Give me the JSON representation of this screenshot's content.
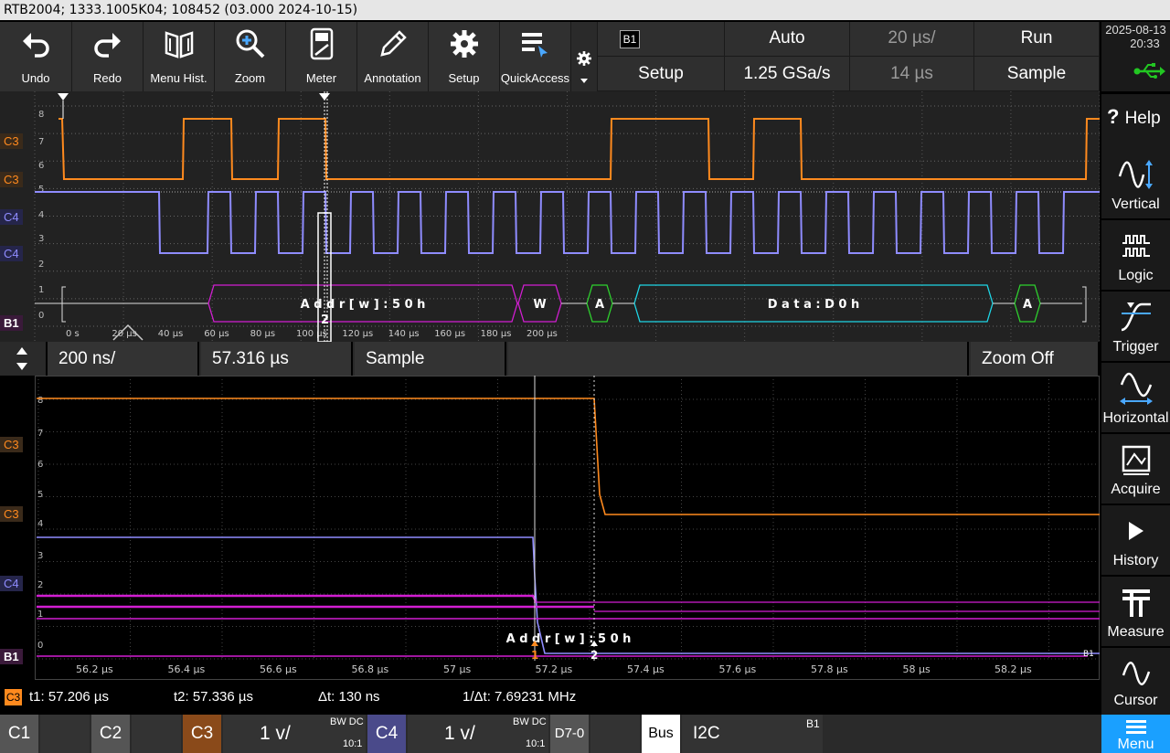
{
  "title": "RTB2004; 1333.1005K04; 108452 (03.000 2024-10-15)",
  "toolbar": {
    "buttons": [
      {
        "label": "Undo",
        "icon": "undo-icon"
      },
      {
        "label": "Redo",
        "icon": "redo-icon"
      },
      {
        "label": "Menu Hist.",
        "icon": "book-icon"
      },
      {
        "label": "Zoom",
        "icon": "zoom-icon"
      },
      {
        "label": "Meter",
        "icon": "meter-icon"
      },
      {
        "label": "Annotation",
        "icon": "pencil-icon"
      },
      {
        "label": "Setup",
        "icon": "gear-icon"
      },
      {
        "label": "QuickAccess",
        "icon": "quickaccess-icon"
      }
    ],
    "bus_tag": "B1",
    "bus_setup": "Setup",
    "trigger_mode": "Auto",
    "sample_rate": "1.25 GSa/s",
    "timebase": "20 µs/",
    "position": "14 µs",
    "run_state": "Run",
    "acq_mode": "Sample"
  },
  "datetime": {
    "date": "2025-08-13",
    "time": "20:33"
  },
  "sidebar": [
    {
      "label": "Help",
      "icon": "help-icon",
      "prefix": "?"
    },
    {
      "label": "Vertical",
      "icon": "vertical-icon"
    },
    {
      "label": "Logic",
      "icon": "logic-icon"
    },
    {
      "label": "Trigger",
      "icon": "trigger-icon"
    },
    {
      "label": "Horizontal",
      "icon": "horizontal-icon"
    },
    {
      "label": "Acquire",
      "icon": "acquire-icon"
    },
    {
      "label": "History",
      "icon": "history-icon"
    },
    {
      "label": "Measure",
      "icon": "measure-icon"
    },
    {
      "label": "Cursor",
      "icon": "cursor-icon"
    }
  ],
  "overview": {
    "y_ticks": [
      "8",
      "7",
      "6",
      "5",
      "4",
      "3",
      "2",
      "1",
      "0"
    ],
    "x_ticks": [
      "0 s",
      "20 µs",
      "40 µs",
      "60 µs",
      "80 µs",
      "100 µs",
      "120 µs",
      "140 µs",
      "160 µs",
      "180 µs",
      "200 µs"
    ],
    "channel_labels": [
      "C3",
      "C3",
      "C4",
      "C4",
      "B1"
    ],
    "decode": [
      "A d d r [ w ] : 5 0 h",
      "W",
      "A",
      "D a t a : D 0 h",
      "A"
    ],
    "marker": "2"
  },
  "zoom": {
    "timebase": "200 ns/",
    "position": "57.316 µs",
    "mode": "Sample",
    "zoom_off": "Zoom Off",
    "y_ticks": [
      "8",
      "7",
      "6",
      "5",
      "4",
      "3",
      "2",
      "1",
      "0"
    ],
    "x_ticks": [
      "56.2 µs",
      "56.4 µs",
      "56.6 µs",
      "56.8 µs",
      "57 µs",
      "57.2 µs",
      "57.4 µs",
      "57.6 µs",
      "57.8 µs",
      "58 µs",
      "58.2 µs"
    ],
    "channel_labels": [
      "C3",
      "C3",
      "C4",
      "B1"
    ],
    "decode": "A d d r [ w ] : 5 0 h",
    "cursor1": "1",
    "cursor2": "2",
    "b1_end": "B1"
  },
  "cursor": {
    "source": "C3",
    "t1": "t1: 57.206 µs",
    "t2": "t2: 57.336 µs",
    "dt": "Δt: 130 ns",
    "inv_dt": "1/Δt: 7.69231 MHz"
  },
  "bottom": {
    "c1": "C1",
    "c2": "C2",
    "c3": "C3",
    "c3_scale": "1 v/",
    "c3_bw": "BW DC",
    "c3_probe": "10:1",
    "c4": "C4",
    "c4_scale": "1 v/",
    "c4_bw": "BW DC",
    "c4_probe": "10:1",
    "d70": "D7-0",
    "bus": "Bus",
    "bus_type": "I2C",
    "bus_tag": "B1",
    "menu": "Menu"
  },
  "colors": {
    "c3": "#ff8a1e",
    "c4": "#8f8cff",
    "b1": "#d21ed2",
    "cyan": "#1ed6e6",
    "green": "#2ed12e",
    "usb": "#22c722",
    "menu": "#1aa0ff"
  }
}
